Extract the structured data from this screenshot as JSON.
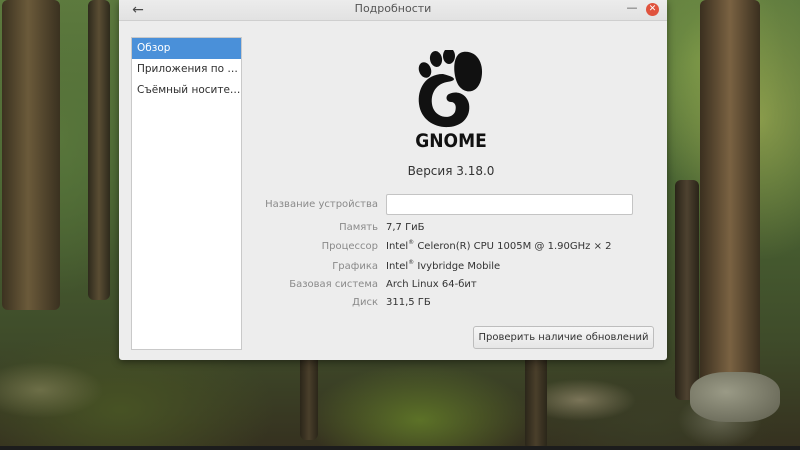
{
  "window": {
    "title": "Подробности",
    "back_icon": "←",
    "minimize_icon": "—",
    "close_icon": "✕",
    "close_color": "#e0533e"
  },
  "sidebar": {
    "selected_color": "#4a90d9",
    "items": [
      {
        "label": "Обзор",
        "selected": true
      },
      {
        "label": "Приложения по умолчанию",
        "selected": false
      },
      {
        "label": "Съёмный носитель",
        "selected": false
      }
    ]
  },
  "overview": {
    "logo_text": "GNOME",
    "version": "Версия 3.18.0",
    "device_name": {
      "label": "Название устройства",
      "value": ""
    },
    "memory": {
      "label": "Память",
      "value": "7,7 ГиБ"
    },
    "processor": {
      "label": "Процессор",
      "brand": "Intel",
      "mark": "®",
      "value": " Celeron(R) CPU 1005M @ 1.90GHz × 2"
    },
    "graphics": {
      "label": "Графика",
      "brand": "Intel",
      "mark": "®",
      "value": " Ivybridge Mobile"
    },
    "os_type": {
      "label": "Базовая система",
      "value": "Arch Linux 64-бит"
    },
    "disk": {
      "label": "Диск",
      "value": "311,5 ГБ"
    },
    "check_updates_label": "Проверить наличие обновлений"
  }
}
